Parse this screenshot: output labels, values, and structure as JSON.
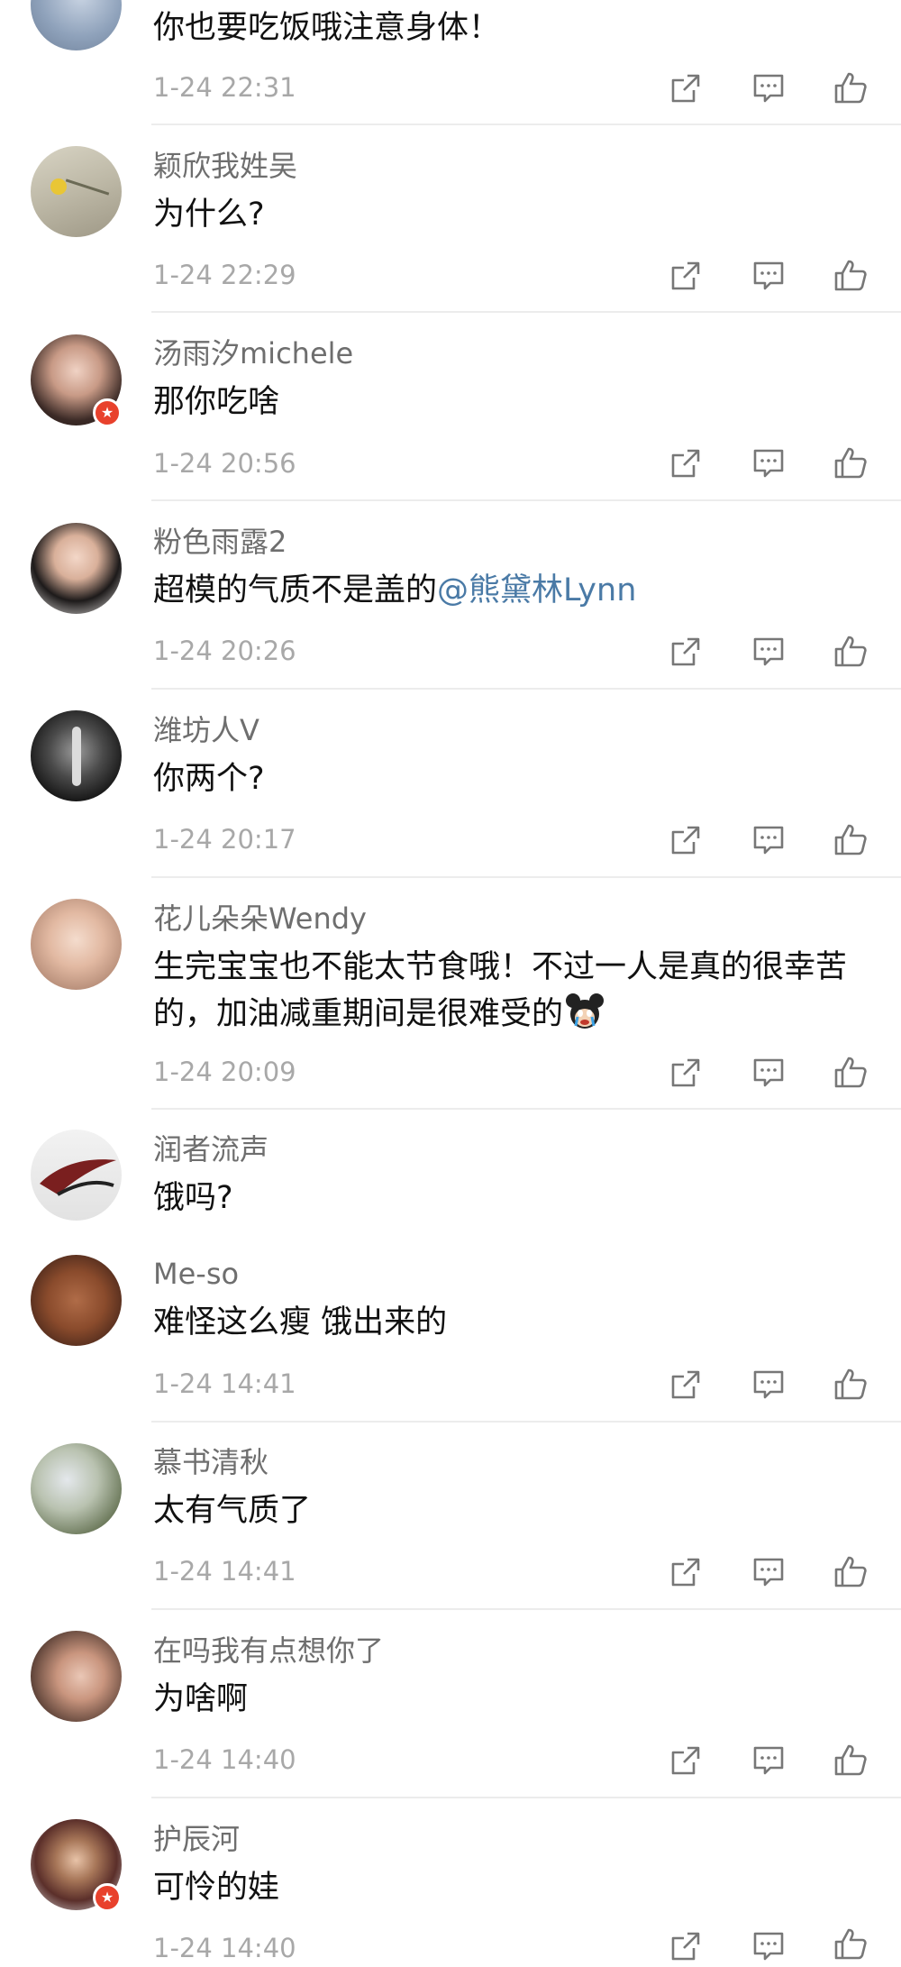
{
  "comments": [
    {
      "username": "",
      "text": "你也要吃饭哦注意身体！",
      "time": "1-24 22:31"
    },
    {
      "username": "颖欣我姓吴",
      "text": "为什么?",
      "time": "1-24 22:29"
    },
    {
      "username": "汤雨汐michele",
      "text": "那你吃啥",
      "time": "1-24 20:56"
    },
    {
      "username": "粉色雨露2",
      "text": "超模的气质不是盖的",
      "mention": "@熊黛林Lynn",
      "time": "1-24 20:26"
    },
    {
      "username": "潍坊人V",
      "text": "你两个?",
      "time": "1-24 20:17"
    },
    {
      "username": "花儿朵朵Wendy",
      "text": "生完宝宝也不能太节食哦！不过一人是真的很幸苦的，加油减重期间是很难受的",
      "time": "1-24 20:09"
    },
    {
      "username": "润者流声",
      "text": "饿吗?"
    },
    {
      "username": "Me-so",
      "text": "难怪这么瘦 饿出来的",
      "time": "1-24 14:41"
    },
    {
      "username": "慕书清秋",
      "text": "太有气质了",
      "time": "1-24 14:41"
    },
    {
      "username": "在吗我有点想你了",
      "text": "为啥啊",
      "time": "1-24 14:40"
    },
    {
      "username": "护辰河",
      "text": "可怜的娃",
      "time": "1-24 14:40"
    }
  ],
  "icons": {
    "share": "share-icon",
    "reply": "comment-icon",
    "like": "thumbs-up-icon"
  },
  "colors": {
    "text": "#111111",
    "username": "#6e6e6e",
    "time": "#a8a8a8",
    "mention": "#4a7aa6",
    "verified_badge": "#e8412c"
  }
}
